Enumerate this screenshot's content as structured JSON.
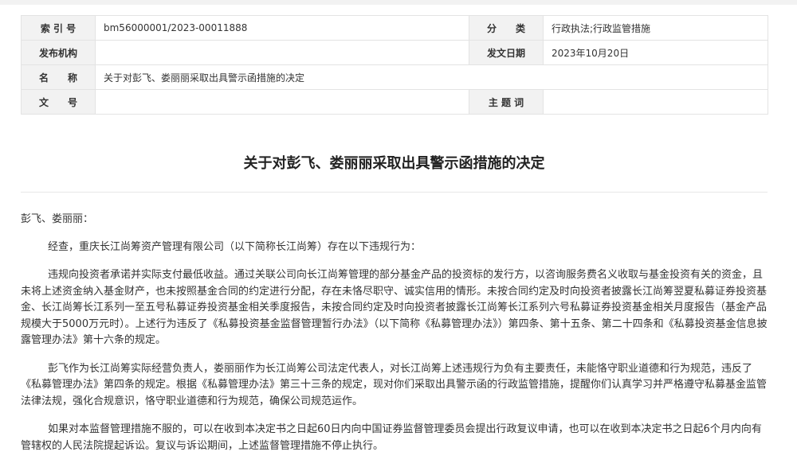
{
  "meta": {
    "index_label": "索 引 号",
    "index_value": "bm56000001/2023-00011888",
    "category_label": "分　　类",
    "category_value": "行政执法;行政监管措施",
    "issuer_label": "发布机构",
    "issuer_value": "",
    "date_label": "发文日期",
    "date_value": "2023年10月20日",
    "name_label": "名　　称",
    "name_value": "关于对彭飞、娄丽丽采取出具警示函措施的决定",
    "docno_label": "文　　号",
    "docno_value": "",
    "keywords_label": "主 题 词",
    "keywords_value": ""
  },
  "document": {
    "title": "关于对彭飞、娄丽丽采取出具警示函措施的决定",
    "salutation": "彭飞、娄丽丽：",
    "paragraphs": [
      "经查，重庆长江尚筹资产管理有限公司（以下简称长江尚筹）存在以下违规行为：",
      "违规向投资者承诺并实际支付最低收益。通过关联公司向长江尚筹管理的部分基金产品的投资标的发行方，以咨询服务费名义收取与基金投资有关的资金，且未将上述资金纳入基金财产，也未按照基金合同的约定进行分配，存在未恪尽职守、诚实信用的情形。未按合同约定及时向投资者披露长江尚筹翌夏私募证券投资基金、长江尚筹长江系列一至五号私募证券投资基金相关季度报告，未按合同约定及时向投资者披露长江尚筹长江系列六号私募证券投资基金相关月度报告（基金产品规模大于5000万元时）。上述行为违反了《私募投资基金监督管理暂行办法》（以下简称《私募管理办法》）第四条、第十五条、第二十四条和《私募投资基金信息披露管理办法》第十六条的规定。",
      "彭飞作为长江尚筹实际经营负责人，娄丽丽作为长江尚筹公司法定代表人，对长江尚筹上述违规行为负有主要责任，未能恪守职业道德和行为规范，违反了《私募管理办法》第四条的规定。根据《私募管理办法》第三十三条的规定，现对你们采取出具警示函的行政监管措施，提醒你们认真学习并严格遵守私募基金监管法律法规，强化合规意识，恪守职业道德和行为规范，确保公司规范运作。",
      "如果对本监督管理措施不服的，可以在收到本决定书之日起60日内向中国证券监督管理委员会提出行政复议申请，也可以在收到本决定书之日起6个月内向有管辖权的人民法院提起诉讼。复议与诉讼期间，上述监督管理措施不停止执行。"
    ]
  }
}
